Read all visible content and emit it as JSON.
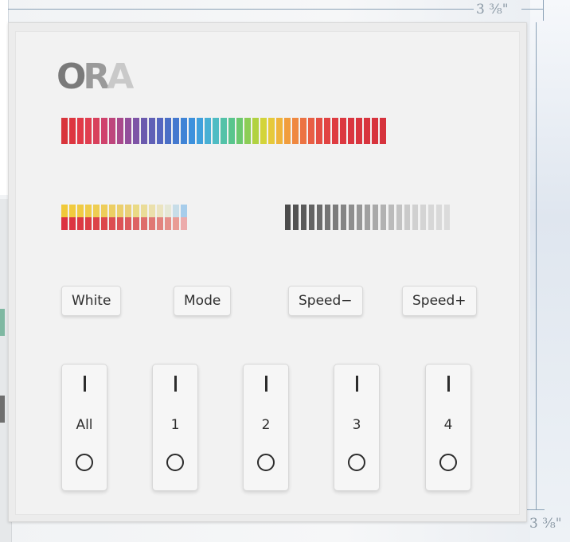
{
  "dimensions": {
    "width_label": "3 ⅜\"",
    "height_label": "3 ⅜\""
  },
  "logo": {
    "text_o": "O",
    "text_r": "R",
    "text_a": "A"
  },
  "colors": {
    "rainbow": [
      "#d8343b",
      "#dd3640",
      "#e13a48",
      "#e03e50",
      "#d8405c",
      "#cf426c",
      "#be457c",
      "#a94a8c",
      "#924f9b",
      "#7e54a6",
      "#6b5aae",
      "#6060b6",
      "#5566bf",
      "#4a6fc6",
      "#4479cf",
      "#3f84d6",
      "#3d91dd",
      "#41a0dc",
      "#49b0d4",
      "#4fbcc3",
      "#53c2a8",
      "#59c58d",
      "#6cc86f",
      "#8ccd56",
      "#b1d241",
      "#d3d43a",
      "#e6c93a",
      "#efb43b",
      "#f19d3d",
      "#ef8840",
      "#ec7343",
      "#e85f44",
      "#e44e43",
      "#e14342",
      "#de3c41",
      "#dc3840",
      "#da3640",
      "#d9353f",
      "#d8343e",
      "#d7333d",
      "#d6333d"
    ],
    "warm_top": [
      "#f0c93a",
      "#f1cb3e",
      "#f0cb44",
      "#efcc4b",
      "#eecd52",
      "#edcd5a",
      "#ecce63",
      "#ebcf6d",
      "#ead078",
      "#eada85",
      "#eadc98",
      "#ebe0ab",
      "#ebe4c0",
      "#e6e8d6",
      "#c7dde8",
      "#a7cdeb"
    ],
    "warm_bottom": [
      "#dc3240",
      "#dc3541",
      "#dc3943",
      "#dc3d45",
      "#dc4248",
      "#dc474c",
      "#dc4d51",
      "#dc5356",
      "#dc5a5c",
      "#dd6363",
      "#de6d6b",
      "#e07874",
      "#e2837e",
      "#e58f89",
      "#e99c95",
      "#ecabab"
    ],
    "dimmer": [
      "#4c4c4c",
      "#535353",
      "#5b5b5b",
      "#636363",
      "#6b6b6b",
      "#747474",
      "#7c7c7c",
      "#858585",
      "#8e8e8e",
      "#979797",
      "#a0a0a0",
      "#a9a9a9",
      "#b2b2b2",
      "#bbbbbb",
      "#c3c3c3",
      "#cacaca",
      "#d0d0d0",
      "#d4d4d4",
      "#d7d7d7",
      "#d9d9d9",
      "#dbdbdb"
    ]
  },
  "buttons": [
    {
      "label": "White"
    },
    {
      "label": "Mode"
    },
    {
      "label": "Speed−"
    },
    {
      "label": "Speed+"
    }
  ],
  "zones": [
    {
      "label": "All"
    },
    {
      "label": "1"
    },
    {
      "label": "2"
    },
    {
      "label": "3"
    },
    {
      "label": "4"
    }
  ]
}
